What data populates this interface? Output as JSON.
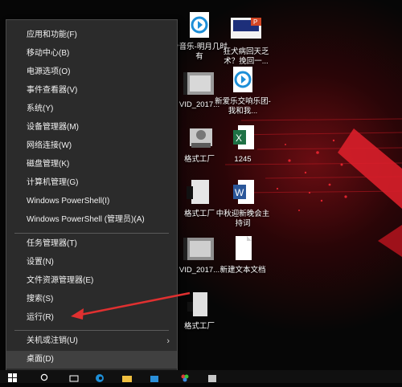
{
  "menu": {
    "items": [
      {
        "label": "应用和功能(F)"
      },
      {
        "label": "移动中心(B)"
      },
      {
        "label": "电源选项(O)"
      },
      {
        "label": "事件查看器(V)"
      },
      {
        "label": "系统(Y)"
      },
      {
        "label": "设备管理器(M)"
      },
      {
        "label": "网络连接(W)"
      },
      {
        "label": "磁盘管理(K)"
      },
      {
        "label": "计算机管理(G)"
      },
      {
        "label": "Windows PowerShell(I)"
      },
      {
        "label": "Windows PowerShell (管理员)(A)"
      },
      {
        "label": "任务管理器(T)"
      },
      {
        "label": "设置(N)"
      },
      {
        "label": "文件资源管理器(E)"
      },
      {
        "label": "搜索(S)"
      },
      {
        "label": "运行(R)"
      },
      {
        "label": "关机或注销(U)"
      },
      {
        "label": "桌面(D)"
      }
    ],
    "submenu_arrow": "›"
  },
  "desktop": {
    "icons": [
      {
        "label": "冷音乐-明月几时有",
        "icon": "media-file-icon"
      },
      {
        "label": "狂犬病回天乏术？挽回一...",
        "icon": "ppt-file-icon"
      },
      {
        "label": "VID_2017...",
        "icon": "video-file-icon"
      },
      {
        "label": "新爱乐交响乐团-我和我...",
        "icon": "media-file-icon"
      },
      {
        "label": "格式工厂",
        "icon": "app-icon"
      },
      {
        "label": "1245",
        "icon": "excel-file-icon"
      },
      {
        "label": "格式工厂",
        "icon": "app-icon"
      },
      {
        "label": "中秋迎新晚会主持词",
        "icon": "word-file-icon"
      },
      {
        "label": "VID_2017...",
        "icon": "video-file-icon"
      },
      {
        "label": "新建文本文档",
        "icon": "text-file-icon"
      },
      {
        "label": "格式工厂",
        "icon": "app-icon"
      }
    ]
  },
  "colors": {
    "menu_bg": "#2b2b2b",
    "accent_red": "#d91f2a",
    "annotation_arrow": "#e03030"
  }
}
